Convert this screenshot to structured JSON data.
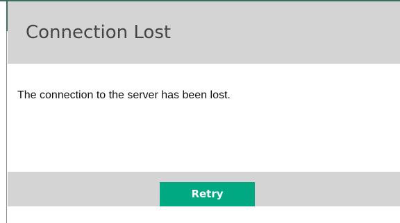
{
  "dialog": {
    "title": "Connection Lost",
    "message": "The connection to the server has been lost.",
    "retry_label": "Retry"
  },
  "colors": {
    "header_background": "#d4d4d4",
    "footer_background": "#d4d4d4",
    "body_background": "#ffffff",
    "primary_button": "#01a982",
    "primary_button_text": "#ffffff",
    "title_text": "#444444",
    "message_text": "#111111",
    "top_accent": "#3b6e5f"
  }
}
